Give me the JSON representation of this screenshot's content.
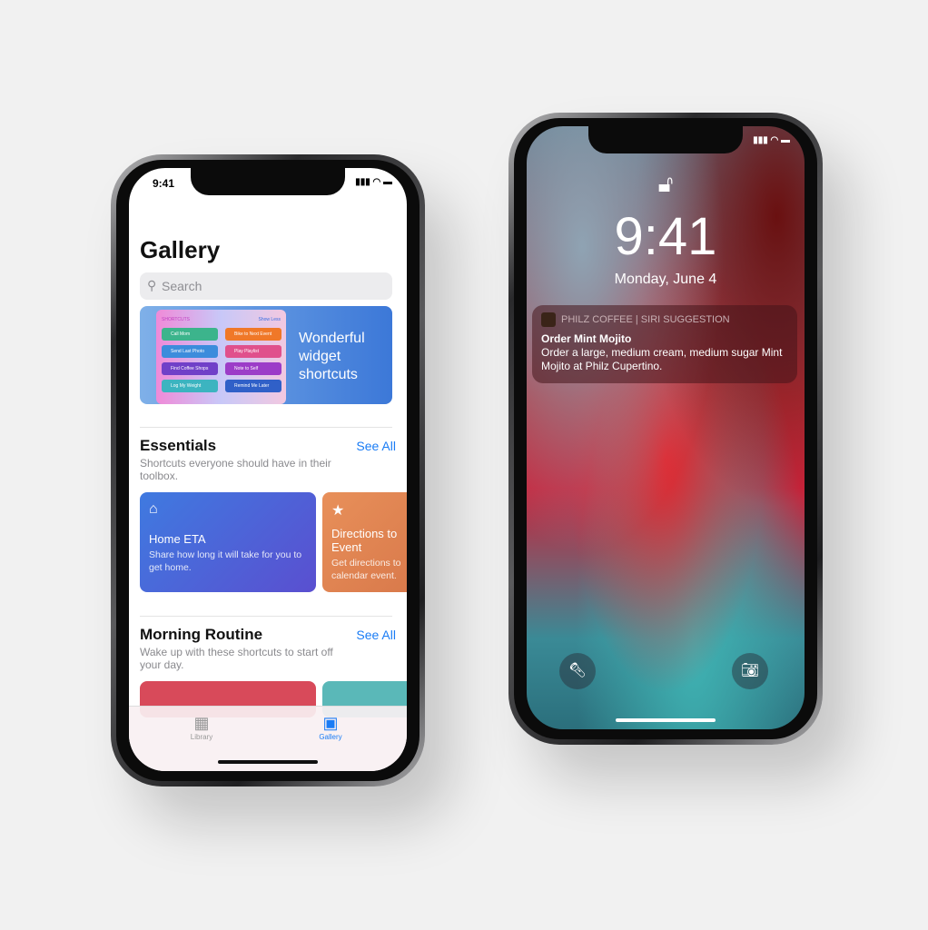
{
  "left_phone": {
    "status": {
      "time": "9:41"
    },
    "title": "Gallery",
    "search": {
      "placeholder": "Search"
    },
    "banner": {
      "title": "Wonderful widget shortcuts",
      "widget_header": "SHORTCUTS",
      "widget_toggle": "Show Less",
      "chips": [
        {
          "label": "Call Mom",
          "color": "#3cb48c"
        },
        {
          "label": "Bike to Next Event",
          "color": "#f07828"
        },
        {
          "label": "Send Last Photo",
          "color": "#3c8cdc"
        },
        {
          "label": "Play Playlist",
          "color": "#e0508c"
        },
        {
          "label": "Find Coffee Shops",
          "color": "#7040c8"
        },
        {
          "label": "Note to Self",
          "color": "#9c3cc8"
        },
        {
          "label": "Log My Weight",
          "color": "#3cb4c0"
        },
        {
          "label": "Remind Me Later",
          "color": "#3060c8"
        }
      ]
    },
    "essentials": {
      "title": "Essentials",
      "see_all": "See All",
      "subtitle": "Shortcuts everyone should have in their toolbox.",
      "cards": [
        {
          "title": "Home ETA",
          "desc": "Share how long it will take for you to get home.",
          "icon": "house-icon",
          "color": "#4a6fd8"
        },
        {
          "title": "Directions to Event",
          "desc": "Get directions to calendar event.",
          "icon": "star-icon",
          "color": "#e58a50"
        }
      ]
    },
    "morning": {
      "title": "Morning Routine",
      "see_all": "See All",
      "subtitle": "Wake up with these shortcuts to start off your day."
    },
    "tabs": [
      {
        "label": "Library",
        "icon": "grid-icon",
        "active": false
      },
      {
        "label": "Gallery",
        "icon": "gallery-icon",
        "active": true
      }
    ],
    "accent": "#1a7cf5"
  },
  "right_phone": {
    "time": "9:41",
    "date": "Monday, June 4",
    "notification": {
      "app": "PHILZ COFFEE | SIRI SUGGESTION",
      "title": "Order Mint Mojito",
      "body": "Order a large, medium cream, medium sugar Mint Mojito at Philz Cupertino."
    },
    "buttons": [
      {
        "icon": "flashlight-icon"
      },
      {
        "icon": "camera-icon"
      }
    ]
  }
}
